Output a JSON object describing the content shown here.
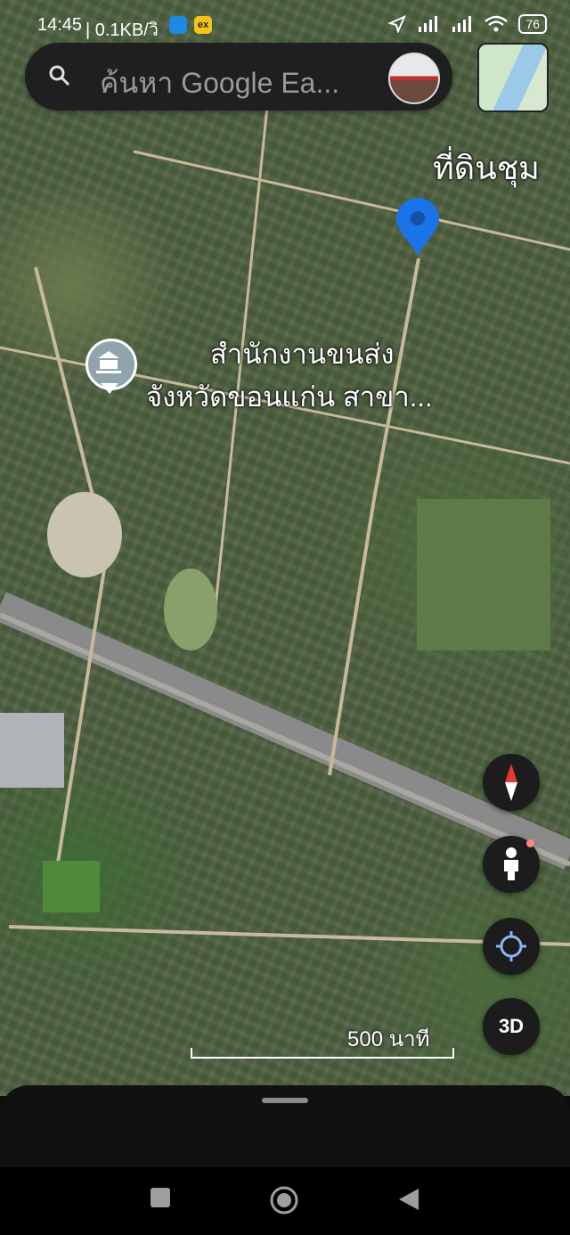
{
  "status_bar": {
    "time": "14:45",
    "network_speed": "| 0.1KB/วิ",
    "app2_label": "ex",
    "battery": "76"
  },
  "search": {
    "placeholder": "ค้นหา Google Ea..."
  },
  "map": {
    "labels": {
      "top_right": "ที่ดินชุม",
      "office_line1": "สำนักงานขนส่ง",
      "office_line2": "จังหวัดขอนแก่น สาขา..."
    },
    "scale_label": "500 นาที"
  },
  "controls": {
    "three_d": "3D"
  },
  "colors": {
    "pin": "#1a73e8",
    "compass_north": "#e53935",
    "notification_dot": "#ff8a80"
  },
  "icons": [
    "search-icon",
    "location-arrow-icon",
    "signal-icon",
    "wifi-icon",
    "map-pin-icon",
    "government-building-icon",
    "compass-icon",
    "street-view-icon",
    "my-location-icon",
    "nav-recents-icon",
    "nav-home-icon",
    "nav-back-icon"
  ]
}
